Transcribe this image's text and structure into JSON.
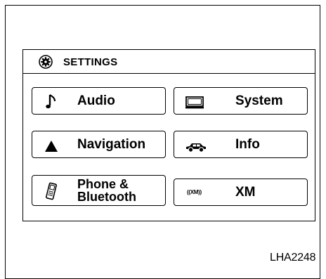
{
  "screen": {
    "title": "SETTINGS",
    "buttons": [
      {
        "id": "audio",
        "label": "Audio",
        "icon": "music-note-icon"
      },
      {
        "id": "system",
        "label": "System",
        "icon": "monitor-icon"
      },
      {
        "id": "navigation",
        "label": "Navigation",
        "icon": "triangle-arrow-icon"
      },
      {
        "id": "info",
        "label": "Info",
        "icon": "car-icon"
      },
      {
        "id": "phone",
        "label_line1": "Phone &",
        "label_line2": "Bluetooth",
        "icon": "cell-phone-icon"
      },
      {
        "id": "xm",
        "label": "XM",
        "icon_text": "((XM))",
        "icon": "xm-radio-icon"
      }
    ]
  },
  "figure_id": "LHA2248"
}
